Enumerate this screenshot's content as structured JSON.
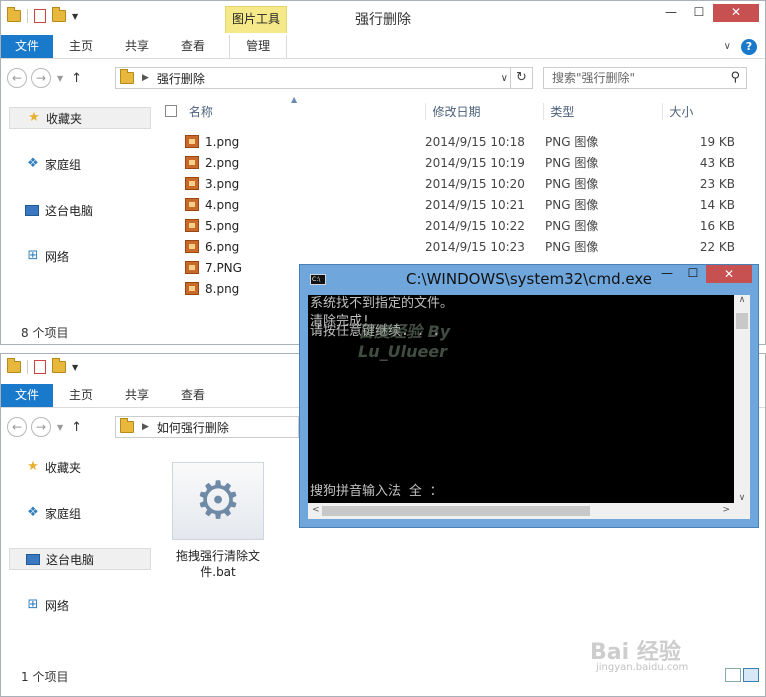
{
  "window1": {
    "title": "强行删除",
    "context_tab": "图片工具",
    "ribbon_tabs": [
      "文件",
      "主页",
      "共享",
      "查看",
      "管理"
    ],
    "address": "强行删除",
    "search_placeholder": "搜索\"强行删除\"",
    "nav": [
      "收藏夹",
      "家庭组",
      "这台电脑",
      "网络"
    ],
    "columns": [
      "名称",
      "修改日期",
      "类型",
      "大小"
    ],
    "files": [
      {
        "name": "1.png",
        "date": "2014/9/15 10:18",
        "type": "PNG 图像",
        "size": "19 KB"
      },
      {
        "name": "2.png",
        "date": "2014/9/15 10:19",
        "type": "PNG 图像",
        "size": "43 KB"
      },
      {
        "name": "3.png",
        "date": "2014/9/15 10:20",
        "type": "PNG 图像",
        "size": "23 KB"
      },
      {
        "name": "4.png",
        "date": "2014/9/15 10:21",
        "type": "PNG 图像",
        "size": "14 KB"
      },
      {
        "name": "5.png",
        "date": "2014/9/15 10:22",
        "type": "PNG 图像",
        "size": "16 KB"
      },
      {
        "name": "6.png",
        "date": "2014/9/15 10:23",
        "type": "PNG 图像",
        "size": "22 KB"
      },
      {
        "name": "7.PNG",
        "date": "",
        "type": "",
        "size": ""
      },
      {
        "name": "8.png",
        "date": "",
        "type": "",
        "size": ""
      }
    ],
    "status": "8 个项目"
  },
  "window2": {
    "ribbon_tabs": [
      "文件",
      "主页",
      "共享",
      "查看"
    ],
    "address": "如何强行删除",
    "nav": [
      "收藏夹",
      "家庭组",
      "这台电脑",
      "网络"
    ],
    "file_name": "拖拽强行清除文件.bat",
    "status": "1 个项目"
  },
  "cmd": {
    "title": "C:\\WINDOWS\\system32\\cmd.exe",
    "icon_label": "C:\\",
    "lines": [
      "系统找不到指定的文件。",
      "清除完成!",
      "",
      "请按任意键继续. . ."
    ],
    "ime": "搜狗拼音输入法 全 ："
  },
  "watermark": {
    "overlay": "百度经验 By",
    "overlay2": "Lu_Ulueer",
    "brand": "Bai 经验",
    "url": "jingyan.baidu.com"
  },
  "icons": {
    "back": "back-arrow-icon",
    "forward": "forward-arrow-icon",
    "up": "up-arrow-icon",
    "refresh": "refresh-icon",
    "search": "search-icon",
    "help": "help-icon",
    "gear_bat": "batch-file-icon"
  },
  "colors": {
    "accent": "#1979ca",
    "close": "#c75050",
    "cmd_frame": "#6fa6dc",
    "context_tab": "#f6e98a"
  }
}
